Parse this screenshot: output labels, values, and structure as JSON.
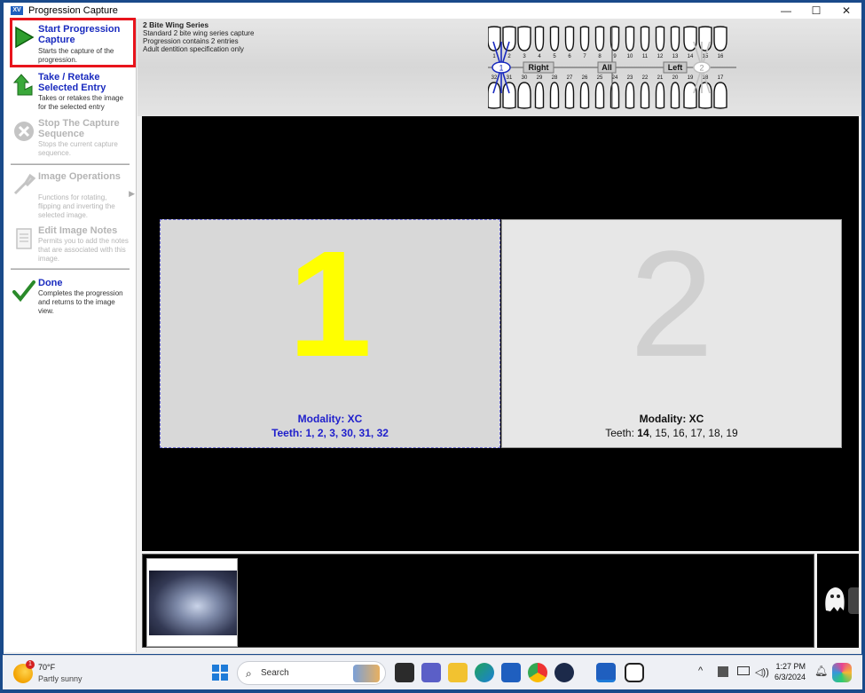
{
  "window": {
    "title": "Progression Capture",
    "app_badge": "XV",
    "controls": [
      "—",
      "☐",
      "✕"
    ]
  },
  "sidebar": {
    "items": [
      {
        "title": "Start Progression Capture",
        "desc": "Starts the capture of the progression.",
        "enabled": true,
        "highlighted": true,
        "icon": "play-icon"
      },
      {
        "title": "Take / Retake Selected Entry",
        "desc": "Takes or retakes the image for the selected entry",
        "enabled": true,
        "icon": "retake-arrow-icon"
      },
      {
        "title": "Stop The Capture Sequence",
        "desc": "Stops the current capture sequence.",
        "enabled": false,
        "icon": "stop-icon"
      },
      {
        "title": "Image Operations",
        "desc": "Functions for rotating, flipping and inverting the selected image.",
        "enabled": false,
        "icon": "wrench-icon"
      },
      {
        "title": "Edit Image Notes",
        "desc": "Permits you to add the notes that are associated with this image.",
        "enabled": false,
        "icon": "notes-icon"
      },
      {
        "title": "Done",
        "desc": "Completes the progression and returns to the image view.",
        "enabled": true,
        "icon": "checkmark-icon"
      }
    ]
  },
  "header": {
    "series_title": "2 Bite Wing Series",
    "line1": "Standard 2 bite wing series capture",
    "line2": "Progression contains 2 entries",
    "line3": "Adult dentition specification only"
  },
  "tooth_chart": {
    "upper_numbers": [
      "1",
      "2",
      "3",
      "4",
      "5",
      "6",
      "7",
      "8",
      "9",
      "10",
      "11",
      "12",
      "13",
      "14",
      "15",
      "16"
    ],
    "lower_numbers": [
      "32",
      "31",
      "30",
      "29",
      "28",
      "27",
      "26",
      "25",
      "24",
      "23",
      "22",
      "21",
      "20",
      "19",
      "18",
      "17"
    ],
    "buttons": {
      "right": "Right",
      "all": "All",
      "left": "Left"
    },
    "selectors": {
      "one": "1",
      "two": "2"
    }
  },
  "slots": [
    {
      "number": "1",
      "modality": "Modality: XC",
      "teeth": "Teeth: 1, 2, 3, 30, 31, 32"
    },
    {
      "number": "2",
      "modality": "Modality: XC",
      "teeth_prefix": "Teeth:",
      "teeth_first": "14",
      "teeth_rest": ", 15, 16, 17, 18, 19"
    }
  ],
  "taskbar": {
    "temperature": "70°F",
    "condition": "Partly sunny",
    "weather_badge": "1",
    "search_label": "Search",
    "time": "1:27 PM",
    "date": "6/3/2024",
    "tray_chevron": "^",
    "colors": {
      "accent": "#1e7bd8",
      "title_blue": "#1a2bbf",
      "highlight_red": "#e8141c"
    }
  }
}
